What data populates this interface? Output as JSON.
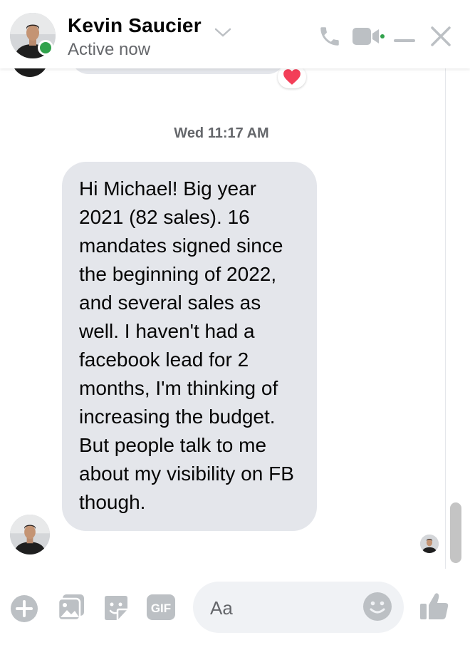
{
  "header": {
    "name": "Kevin Saucier",
    "status": "Active now"
  },
  "conversation": {
    "timestamp": "Wed 11:17 AM",
    "previous_reaction": "❤️",
    "message": "Hi Michael! Big year 2021 (82 sales). 16 mandates signed since the beginning of 2022, and several sales as well. I haven't had a facebook lead for 2 months, I'm thinking of increasing the budget. But people talk to me about my visibility on FB though."
  },
  "composer": {
    "placeholder": "Aa",
    "gif_label": "GIF"
  },
  "icons": {
    "header": [
      "chevron-down-icon",
      "phone-icon",
      "video-camera-icon",
      "minimize-icon",
      "close-icon"
    ],
    "composer": [
      "plus-icon",
      "photo-icon",
      "sticker-icon",
      "gif-icon",
      "emoji-icon",
      "thumbs-up-icon"
    ]
  },
  "colors": {
    "icon_gray": "#bcc0c4",
    "bubble_gray": "#e4e6eb",
    "active_green": "#31a24c",
    "heart_red": "#f33e58"
  }
}
